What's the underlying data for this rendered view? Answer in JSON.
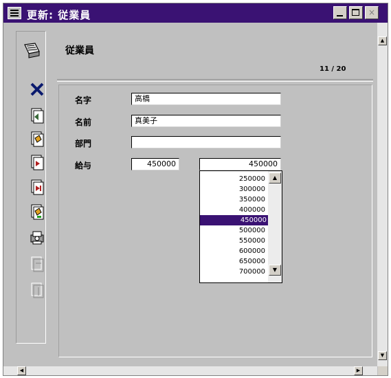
{
  "window": {
    "title": "更新: 従業員",
    "minimize_label": "_",
    "maximize_label": "□",
    "close_label": "×"
  },
  "header": {
    "title": "従業員",
    "record_counter": "11 / 20"
  },
  "toolbar": {
    "icons": [
      "calendar-icon",
      "delete-x-icon",
      "first-record-icon",
      "prev-record-icon",
      "next-record-icon",
      "last-record-icon",
      "edit-record-icon",
      "print-icon",
      "disabled-tool-icon",
      "disabled-tool-icon"
    ]
  },
  "form": {
    "fields": [
      {
        "label": "名字",
        "value": "高橋"
      },
      {
        "label": "名前",
        "value": "真美子"
      },
      {
        "label": "部門",
        "value": ""
      },
      {
        "label": "給与",
        "value": "450000"
      }
    ],
    "salary_select": {
      "selected": "450000",
      "options": [
        "250000",
        "300000",
        "350000",
        "400000",
        "450000",
        "500000",
        "550000",
        "600000",
        "650000",
        "700000"
      ]
    }
  },
  "colors": {
    "titlebar": "#3a1273",
    "selection": "#3a1273",
    "window_bg": "#c0c0c0"
  }
}
